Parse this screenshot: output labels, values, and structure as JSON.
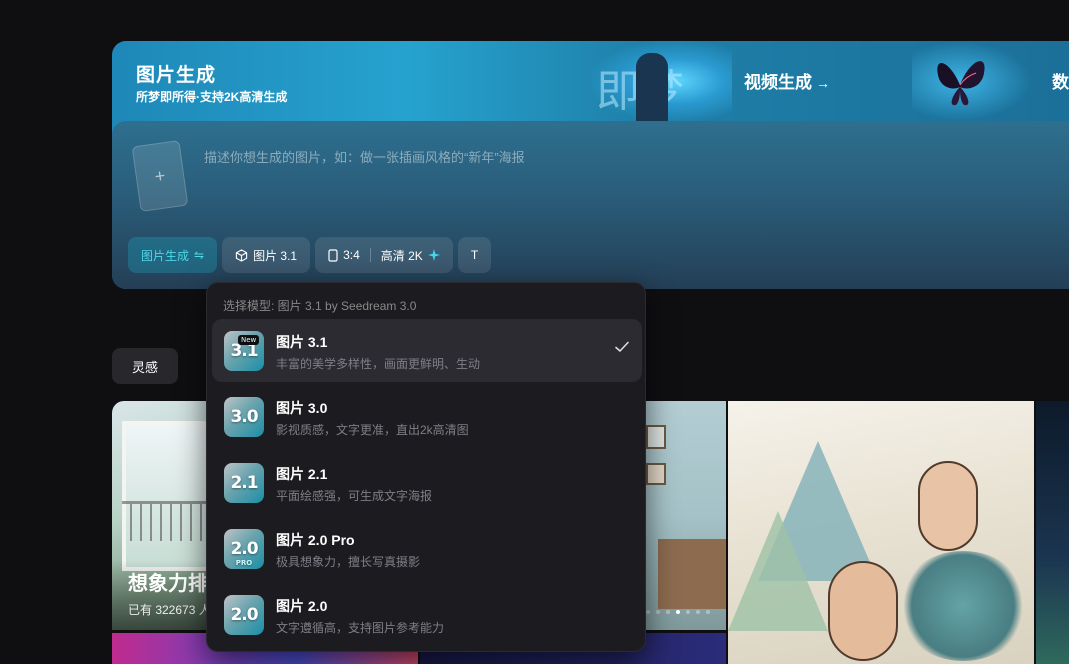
{
  "hero": {
    "title": "图片生成",
    "subtitle": "所梦即所得·支持2K高清生成",
    "art_text": "即梦",
    "video_link": "视频生成",
    "video_arrow": "→",
    "more_link": "数",
    "prompt_placeholder": "描述你想生成的图片，如：做一张插画风格的“新年”海报",
    "upload_symbol": "+"
  },
  "toolbar": {
    "mode_label": "图片生成",
    "mode_icon": "⇋",
    "model_label": "图片 3.1",
    "ratio_label": "3:4",
    "quality_label": "高清 2K",
    "text_tool_symbol": "T"
  },
  "tabs": {
    "inspiration": "灵感"
  },
  "gallery": {
    "title": "想象力排",
    "subtitle": "已有 322673 人"
  },
  "dropdown": {
    "header": "选择模型: 图片 3.1 by Seedream 3.0",
    "items": [
      {
        "icon_text": "3.1",
        "badge": "New",
        "name": "图片 3.1",
        "desc": "丰富的美学多样性，画面更鲜明、生动",
        "selected": true
      },
      {
        "icon_text": "3.0",
        "name": "图片 3.0",
        "desc": "影视质感，文字更准，直出2k高清图"
      },
      {
        "icon_text": "2.1",
        "name": "图片 2.1",
        "desc": "平面绘感强，可生成文字海报"
      },
      {
        "icon_text": "2.0",
        "icon_sub": "PRO",
        "name": "图片 2.0 Pro",
        "desc": "极具想象力，擅长写真摄影"
      },
      {
        "icon_text": "2.0",
        "name": "图片 2.0",
        "desc": "文字遵循高，支持图片参考能力"
      }
    ]
  },
  "colors": {
    "accent": "#3fd8ef",
    "hero_blue": "#26a2cf",
    "dropdown_bg": "#1c1c20"
  }
}
